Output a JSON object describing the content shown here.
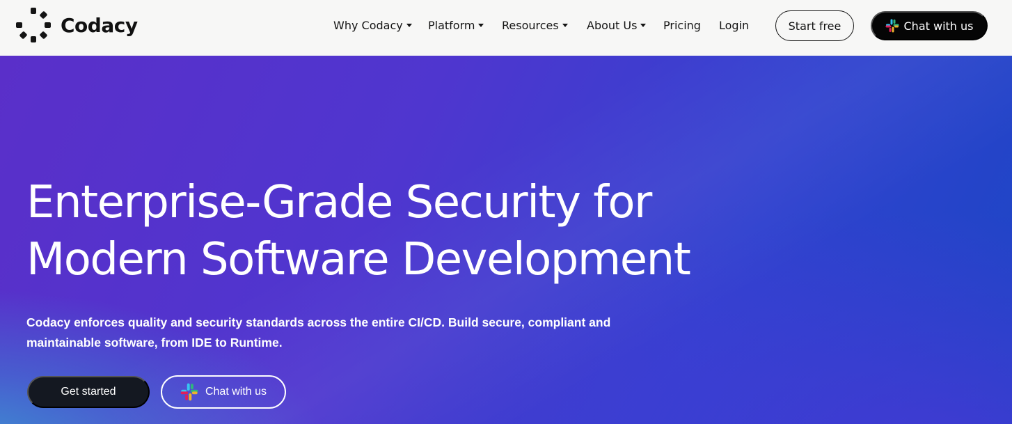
{
  "brand": {
    "name": "Codacy",
    "logo_icon": "codacy-ring-icon"
  },
  "nav": {
    "items": [
      {
        "label": "Why Codacy",
        "has_dropdown": true
      },
      {
        "label": "Platform",
        "has_dropdown": true
      },
      {
        "label": "Resources",
        "has_dropdown": true
      },
      {
        "label": "About Us",
        "has_dropdown": true
      },
      {
        "label": "Pricing",
        "has_dropdown": false
      },
      {
        "label": "Login",
        "has_dropdown": false
      }
    ],
    "start_free_label": "Start free",
    "chat_label": "Chat with us",
    "chat_icon": "slack-icon"
  },
  "hero": {
    "title_lines": [
      "Enterprise-Grade Security for",
      "Modern Software Development"
    ],
    "subtitle_lines": [
      "Codacy enforces quality and security standards across the entire CI/CD. Build secure, compliant and",
      "maintainable software, from IDE to Runtime."
    ],
    "primary_cta": "Get started",
    "secondary_cta": "Chat with us"
  },
  "colors": {
    "header_bg": "#f7f7f6",
    "hero_gradient_start": "#5a2fc9",
    "hero_gradient_end": "#1b46c4",
    "dark_button": "#141821",
    "slack_blue": "#36c5f0",
    "slack_green": "#2eb67d",
    "slack_red": "#e01e5a",
    "slack_yellow": "#ecb22e"
  }
}
